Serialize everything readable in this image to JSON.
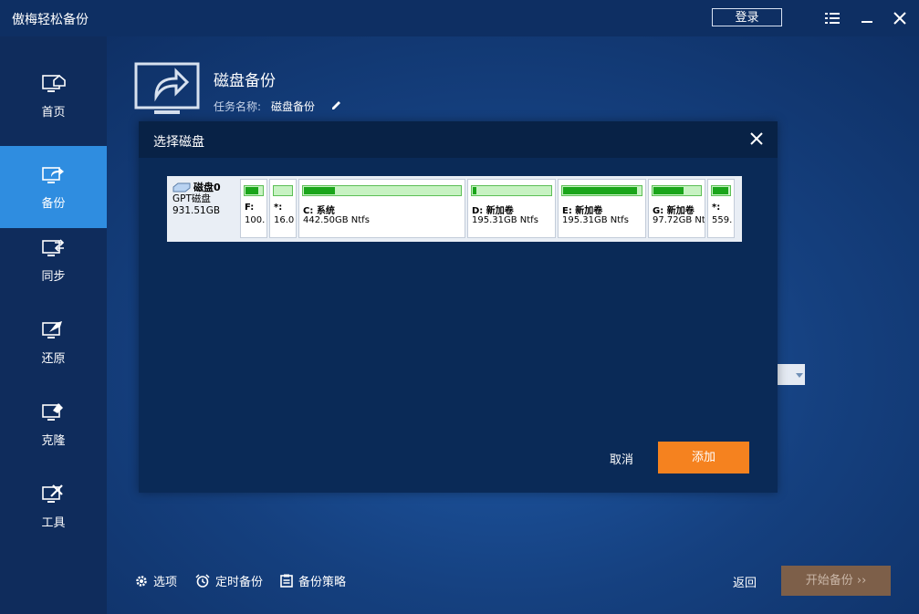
{
  "app": {
    "title": "傲梅轻松备份",
    "login_label": "登录"
  },
  "sidebar": {
    "items": [
      {
        "label": "首页"
      },
      {
        "label": "备份"
      },
      {
        "label": "同步"
      },
      {
        "label": "还原"
      },
      {
        "label": "克隆"
      },
      {
        "label": "工具"
      }
    ]
  },
  "page": {
    "title": "磁盘备份",
    "task_name_label": "任务名称:",
    "task_name_value": "磁盘备份"
  },
  "dialog": {
    "title": "选择磁盘",
    "disk": {
      "name": "磁盘0",
      "type": "GPT磁盘",
      "size": "931.51GB",
      "partitions": [
        {
          "label": "F:",
          "size": "100.",
          "fill": 0.8
        },
        {
          "label": "*:",
          "size": "16.0",
          "fill": 0.0
        },
        {
          "label": "C: 系统",
          "size": "442.50GB Ntfs",
          "fill": 0.2
        },
        {
          "label": "D: 新加卷",
          "size": "195.31GB Ntfs",
          "fill": 0.05
        },
        {
          "label": "E: 新加卷",
          "size": "195.31GB Ntfs",
          "fill": 0.95
        },
        {
          "label": "G: 新加卷",
          "size": "97.72GB Nt",
          "fill": 0.65
        },
        {
          "label": "*:",
          "size": "559.",
          "fill": 0.95
        }
      ]
    },
    "cancel_label": "取消",
    "add_label": "添加"
  },
  "footer": {
    "options_label": "选项",
    "schedule_label": "定时备份",
    "policy_label": "备份策略",
    "back_label": "返回",
    "start_label": "开始备份 ››"
  },
  "colors": {
    "accent_orange": "#f5821f",
    "active_nav": "#2f8de0",
    "usage_green": "#1aa51a"
  }
}
